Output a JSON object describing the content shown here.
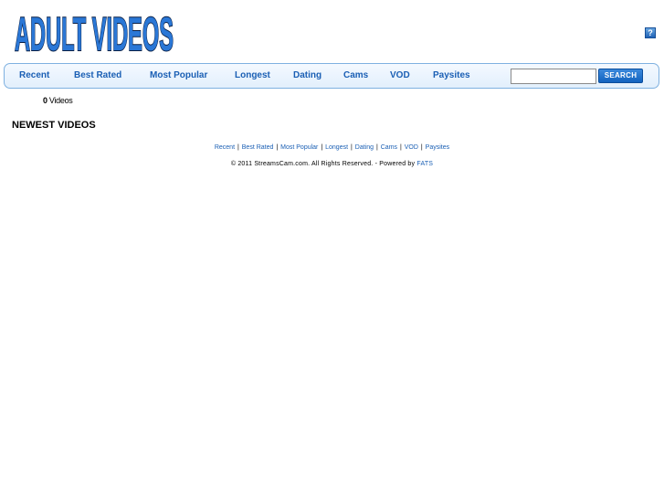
{
  "header": {
    "logo_text": "ADULT VIDEOS",
    "help_label": "?"
  },
  "nav": {
    "items": [
      {
        "label": "Recent"
      },
      {
        "label": "Best Rated"
      },
      {
        "label": "Most Popular"
      },
      {
        "label": "Longest"
      },
      {
        "label": "Dating"
      },
      {
        "label": "Cams"
      },
      {
        "label": "VOD"
      },
      {
        "label": "Paysites"
      }
    ],
    "search_value": "",
    "search_button": "SEARCH"
  },
  "main": {
    "video_count": "0",
    "video_count_label": "Videos",
    "section_title": "NEWEST VIDEOS"
  },
  "footer": {
    "links": [
      "Recent",
      "Best Rated",
      "Most Popular",
      "Longest",
      "Dating",
      "Cams",
      "VOD",
      "Paysites"
    ],
    "separator": "|",
    "copyright": "© 2011 StreamsCam.com. All Rights Reserved. - Powered by ",
    "powered_by": "FATS"
  },
  "colors": {
    "link_blue": "#1a5fb4",
    "logo_blue": "#2a77d6",
    "nav_border": "#7fb1e0"
  }
}
